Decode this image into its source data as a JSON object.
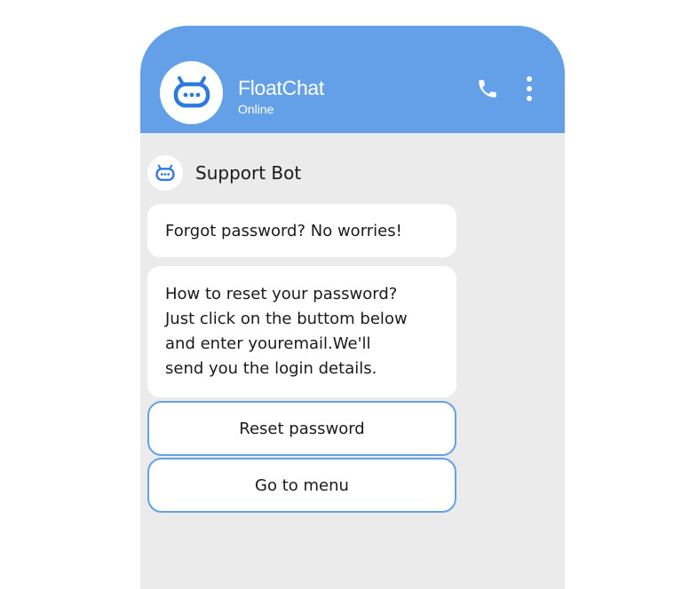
{
  "header": {
    "title": "FloatChat",
    "status": "Online",
    "background_color": "#63a0e8",
    "icons": [
      "bot-logo-icon",
      "phone-icon",
      "more-vertical-icon"
    ]
  },
  "chat": {
    "bot_name": "Support Bot",
    "messages": [
      {
        "from": "bot",
        "text": "Forgot password? No worries!"
      },
      {
        "from": "bot",
        "text": "How to reset your password?\nJust click on the buttom below\nand enter youremail.We'll\nsend you the login details."
      }
    ],
    "quick_replies": [
      {
        "label": "Reset password"
      },
      {
        "label": "Go to menu"
      }
    ],
    "accent_color": "#63a0e8",
    "background_color": "#ebebeb"
  }
}
